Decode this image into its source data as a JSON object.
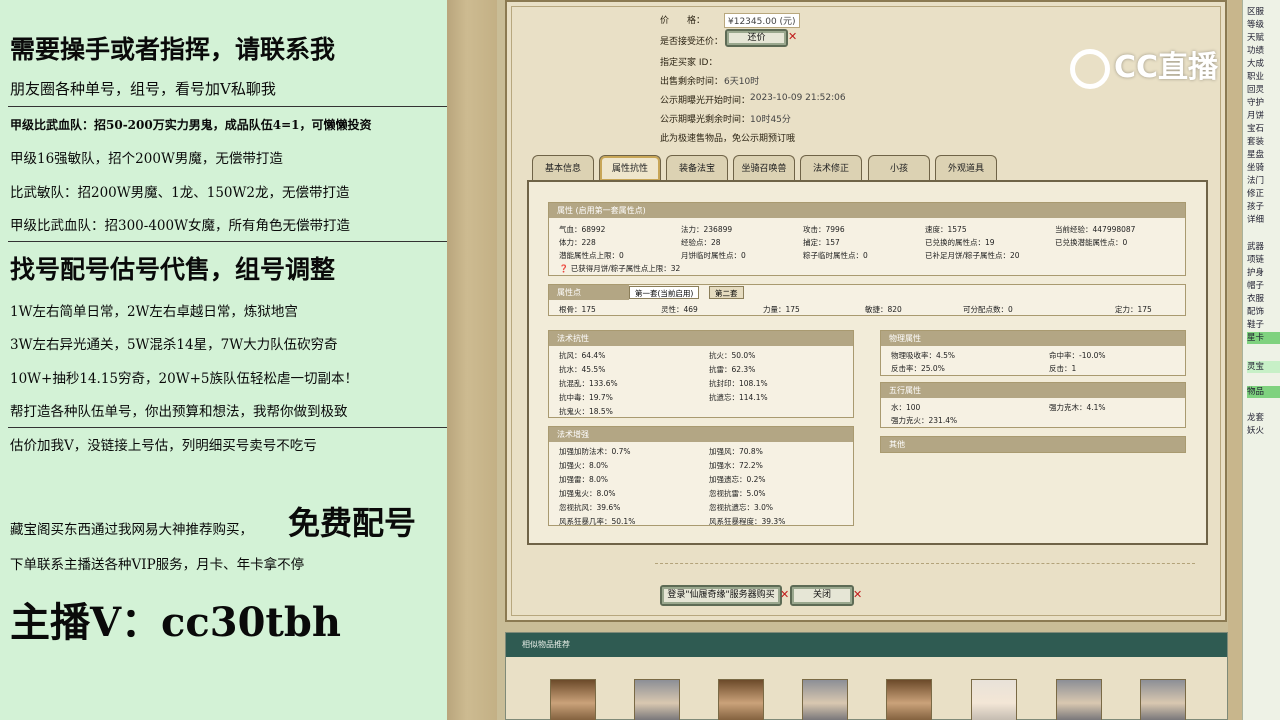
{
  "promo": {
    "l1": "需要操手或者指挥，请联系我",
    "l2": "朋友圈各种单号，组号，看号加V私聊我",
    "l3": "甲级比武血队：招50-200万实力男鬼，成品队伍4=1，可懒懒投资",
    "l4": "甲级16强敏队，招个200W男魔，无偿带打造",
    "l5": "比武敏队：招200W男魔、1龙、150W2龙，无偿带打造",
    "l6": "甲级比武血队：招300-400W女魔，所有角色无偿带打造",
    "l7": "找号配号估号代售，组号调整",
    "l8": "1W左右简单日常，2W左右卓越日常，炼狱地宫",
    "l9": "3W左右异光通关，5W混杀14星，7W大力队伍砍穷奇",
    "l10": "10W+抽秒14.15穷奇，20W+5族队伍轻松虐一切副本！",
    "l11": "帮打造各种队伍单号，你出预算和想法，我帮你做到极致",
    "l12": "估价加我V，没链接上号估，列明细买号卖号不吃亏",
    "l13a": "藏宝阁买东西通过我网易大神推荐购买，",
    "l13b": "免费配号",
    "l14": "下单联系主播送各种VIP服务，月卡、年卡拿不停",
    "l15": "主播V：cc30tbh"
  },
  "logo": {
    "text": "CC直播"
  },
  "listing": {
    "price_label": "价　　格：",
    "price_value": "¥12345.00 (元)",
    "bargain_label": "是否接受还价：",
    "bargain_button": "还价",
    "buyer_label": "指定买家 ID：",
    "remain_label": "出售剩余时间：",
    "remain_value": "6天10时",
    "public_start_label": "公示期曝光开始时间：",
    "public_start_value": "2023-10-09 21:52:06",
    "public_remain_label": "公示期曝光剩余时间：",
    "public_remain_value": "10时45分",
    "note": "此为极速售物品，免公示期预订哦"
  },
  "tabs": [
    "基本信息",
    "属性抗性",
    "装备法宝",
    "坐骑召唤兽",
    "法术修正",
    "小孩",
    "外观道具"
  ],
  "attr": {
    "header": "属性 (启用第一套属性点)",
    "rows": [
      [
        "气血：68992",
        "法力：236899",
        "攻击：7996",
        "速度：1575",
        "当前经验：447998087"
      ],
      [
        "体力：228",
        "经验点：28",
        "捕定：157",
        "已兑换的属性点：19",
        "已兑换潜能属性点：0"
      ],
      [
        "潜能属性点上限：0",
        "月饼临时属性点：0",
        "粽子临时属性点：0",
        "已补足月饼/粽子属性点：20",
        ""
      ]
    ],
    "footer": "已获得月饼/粽子属性点上限：32"
  },
  "points": {
    "header": "属性点",
    "tab1": "第一套(当前启用)",
    "tab2": "第二套",
    "values": [
      "根骨：175",
      "灵性：469",
      "力量：175",
      "敏捷：820",
      "可分配点数：0",
      "定力：175"
    ]
  },
  "resist": {
    "header": "法术抗性",
    "left": [
      "抗风：64.4%",
      "抗水：45.5%",
      "抗混乱：133.6%",
      "抗中毒：19.7%",
      "抗鬼火：18.5%"
    ],
    "right": [
      "抗火：50.0%",
      "抗雷：62.3%",
      "抗封印：108.1%",
      "抗遗忘：114.1%"
    ]
  },
  "boost": {
    "header": "法术增强",
    "left": [
      "加强加防法术：0.7%",
      "加强火：8.0%",
      "加强雷：8.0%",
      "加强鬼火：8.0%",
      "忽视抗风：39.6%",
      "风系狂暴几率：50.1%"
    ],
    "right": [
      "加强风：70.8%",
      "加强水：72.2%",
      "加强遗忘：0.2%",
      "忽视抗雷：5.0%",
      "忽视抗遗忘：3.0%",
      "风系狂暴程度：39.3%"
    ]
  },
  "physical": {
    "header": "物理属性",
    "rows": [
      [
        "物理吸收率：4.5%",
        "命中率：-10.0%"
      ],
      [
        "反击率：25.0%",
        "反击：1"
      ]
    ]
  },
  "five": {
    "header": "五行属性",
    "rows": [
      [
        "水：100",
        "强力克木：4.1%"
      ],
      [
        "强力克火：231.4%",
        ""
      ]
    ]
  },
  "other": {
    "header": "其他"
  },
  "actions": {
    "login": "登录\"仙履奇缘\"服务器购买",
    "close": "关闭"
  },
  "recommend": {
    "header": "相似物品推荐"
  },
  "rcol": [
    "区服",
    "等级",
    "天赋",
    "功绩",
    "大成",
    "职业",
    "回灵",
    "守护",
    "月饼",
    "宝石",
    "套装",
    "星盘",
    "坐骑",
    "法门",
    "修正",
    "孩子",
    "详细",
    "",
    "武器",
    "项链",
    "护身",
    "帽子",
    "衣服",
    "配饰",
    "鞋子",
    "星卡",
    "",
    "灵宝",
    "",
    "物品",
    "",
    "龙套",
    "妖火"
  ]
}
